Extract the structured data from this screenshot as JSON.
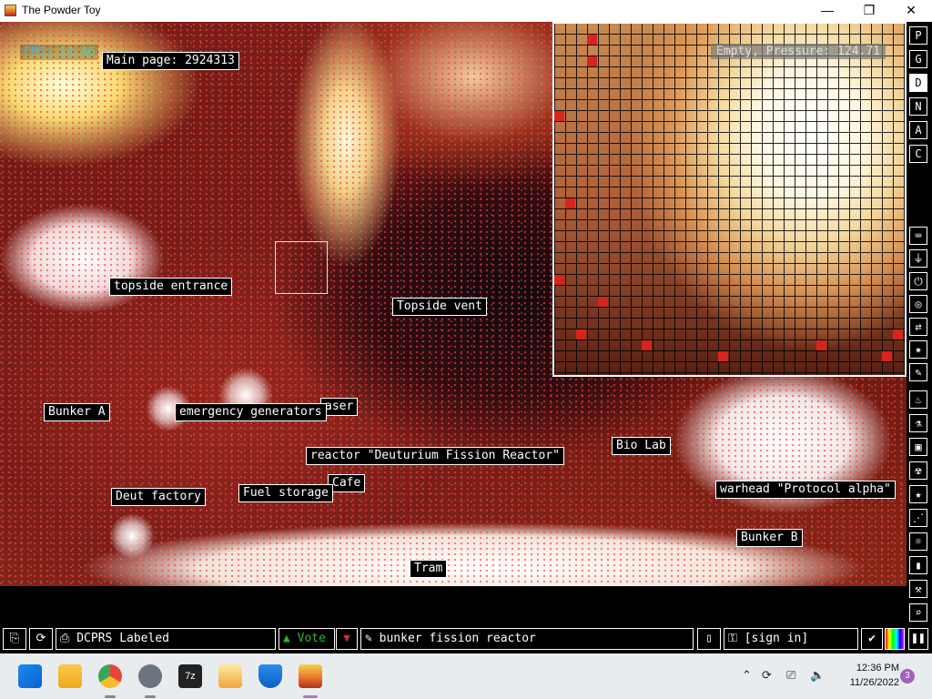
{
  "window": {
    "title": "The Powder Toy",
    "min_glyph": "—",
    "max_glyph": "❐",
    "close_glyph": "✕"
  },
  "hud": {
    "fps_label": "FPS:",
    "fps_value": "14.46",
    "main_page": "Main page: 2924313",
    "pressure": "Empty, Pressure: 124.71"
  },
  "signs": [
    {
      "text": "topside entrance"
    },
    {
      "text": "Topside vent"
    },
    {
      "text": "aser"
    },
    {
      "text": "Bunker A"
    },
    {
      "text": "emergency generators"
    },
    {
      "text": "reactor \"Deuturium Fission Reactor\""
    },
    {
      "text": "Bio Lab"
    },
    {
      "text": "Cafe"
    },
    {
      "text": "Deut factory"
    },
    {
      "text": "Fuel storage"
    },
    {
      "text": "warhead \"Protocol alpha\""
    },
    {
      "text": "Bunker B"
    },
    {
      "text": "Tram"
    }
  ],
  "sidebar": {
    "modes": [
      "P",
      "G",
      "D",
      "N",
      "A",
      "C"
    ],
    "active_mode": "D",
    "tools": [
      "keyboard-icon",
      "plug-icon",
      "power-icon",
      "sensor-icon",
      "arrows-icon",
      "explosive-icon",
      "brush-icon",
      "fire-icon",
      "flask-icon",
      "wall-icon",
      "radiation-icon",
      "star-icon",
      "dots-icon",
      "bulb-icon",
      "bookmark-icon",
      "tool-icon",
      "search-icon"
    ]
  },
  "bottombar": {
    "save_name": "DCPRS Labeled",
    "vote_label": "Vote",
    "description": "bunker fission reactor",
    "sign_in": "[sign in]"
  },
  "taskbar": {
    "apps": [
      "start-icon",
      "file-explorer-icon",
      "chrome-icon",
      "settings-icon",
      "7zip-icon",
      "photos-icon",
      "defender-icon",
      "powder-toy-icon"
    ],
    "time": "12:36 PM",
    "date": "11/26/2022",
    "notifications": "3"
  },
  "colors": {
    "fps": "#3fb8e0",
    "vote_up": "#30b030",
    "vote_down": "#c03030",
    "taskbar": "#e9ecef"
  }
}
